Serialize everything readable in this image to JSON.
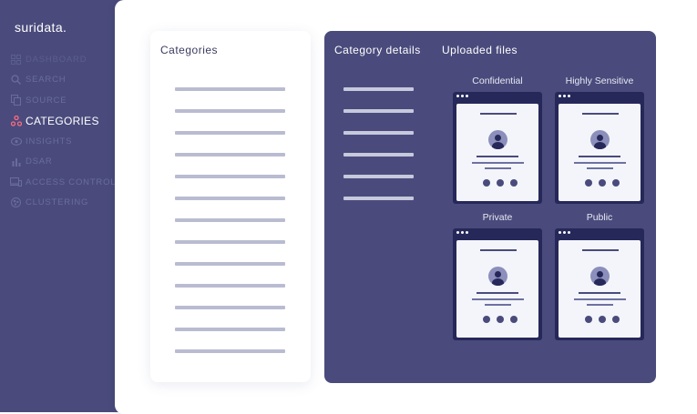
{
  "brand": {
    "name": "suridata."
  },
  "sidebar": {
    "items": [
      {
        "label": "DASHBOARD",
        "icon": "grid-icon"
      },
      {
        "label": "SEARCH",
        "icon": "search-icon"
      },
      {
        "label": "SOURCE",
        "icon": "copy-icon"
      },
      {
        "label": "CATEGORIES",
        "icon": "triangle-nodes-icon",
        "active": true
      },
      {
        "label": "INSIGHTS",
        "icon": "eye-icon"
      },
      {
        "label": "DSAR",
        "icon": "bar-chart-icon"
      },
      {
        "label": "ACCESS CONTROL",
        "icon": "devices-icon"
      },
      {
        "label": "CLUSTERING",
        "icon": "cluster-icon"
      }
    ]
  },
  "colors": {
    "sidebar_bg": "#4a4b7c",
    "active_icon": "#ff6b81",
    "file_card_bg": "#26285a"
  },
  "categories_panel": {
    "title": "Categories"
  },
  "details_panel": {
    "tabs": [
      {
        "label": "Category details"
      },
      {
        "label": "Uploaded files"
      }
    ],
    "files": [
      {
        "label": "Confidential"
      },
      {
        "label": "Highly Sensitive"
      },
      {
        "label": "Private"
      },
      {
        "label": "Public"
      }
    ]
  }
}
